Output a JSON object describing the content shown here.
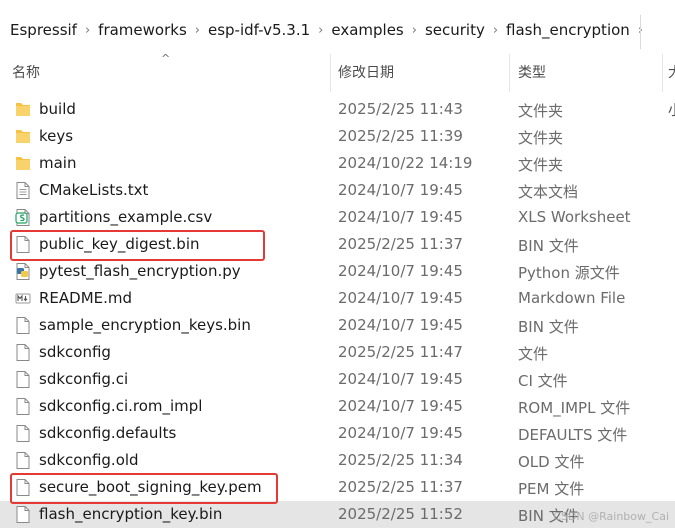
{
  "breadcrumb": [
    "Espressif",
    "frameworks",
    "esp-idf-v5.3.1",
    "examples",
    "security",
    "flash_encryption"
  ],
  "columns": {
    "name": "名称",
    "date": "修改日期",
    "type": "类型",
    "size": "大小"
  },
  "files": [
    {
      "name": "build",
      "date": "2025/2/25 11:43",
      "type": "文件夹",
      "icon": "folder-icon"
    },
    {
      "name": "keys",
      "date": "2025/2/25 11:39",
      "type": "文件夹",
      "icon": "folder-icon"
    },
    {
      "name": "main",
      "date": "2024/10/22 14:19",
      "type": "文件夹",
      "icon": "folder-icon"
    },
    {
      "name": "CMakeLists.txt",
      "date": "2024/10/7 19:45",
      "type": "文本文档",
      "icon": "text-file-icon"
    },
    {
      "name": "partitions_example.csv",
      "date": "2024/10/7 19:45",
      "type": "XLS Worksheet",
      "icon": "spreadsheet-file-icon"
    },
    {
      "name": "public_key_digest.bin",
      "date": "2025/2/25 11:37",
      "type": "BIN 文件",
      "icon": "file-icon",
      "highlighted": true
    },
    {
      "name": "pytest_flash_encryption.py",
      "date": "2024/10/7 19:45",
      "type": "Python 源文件",
      "icon": "python-file-icon"
    },
    {
      "name": "README.md",
      "date": "2024/10/7 19:45",
      "type": "Markdown File",
      "icon": "markdown-file-icon"
    },
    {
      "name": "sample_encryption_keys.bin",
      "date": "2024/10/7 19:45",
      "type": "BIN 文件",
      "icon": "file-icon"
    },
    {
      "name": "sdkconfig",
      "date": "2025/2/25 11:47",
      "type": "文件",
      "icon": "file-icon"
    },
    {
      "name": "sdkconfig.ci",
      "date": "2024/10/7 19:45",
      "type": "CI 文件",
      "icon": "file-icon"
    },
    {
      "name": "sdkconfig.ci.rom_impl",
      "date": "2024/10/7 19:45",
      "type": "ROM_IMPL 文件",
      "icon": "file-icon"
    },
    {
      "name": "sdkconfig.defaults",
      "date": "2024/10/7 19:45",
      "type": "DEFAULTS 文件",
      "icon": "file-icon"
    },
    {
      "name": "sdkconfig.old",
      "date": "2025/2/25 11:34",
      "type": "OLD 文件",
      "icon": "file-icon"
    },
    {
      "name": "secure_boot_signing_key.pem",
      "date": "2025/2/25 11:37",
      "type": "PEM 文件",
      "icon": "file-icon",
      "highlighted": true
    },
    {
      "name": "flash_encryption_key.bin",
      "date": "2025/2/25 11:52",
      "type": "BIN 文件",
      "icon": "file-icon",
      "selected": true
    }
  ],
  "watermark": "CSDN @Rainbow_Cai",
  "colors": {
    "highlight": "#e53935",
    "folder": "#f5c242",
    "selected_row": "#e5e5e5"
  }
}
